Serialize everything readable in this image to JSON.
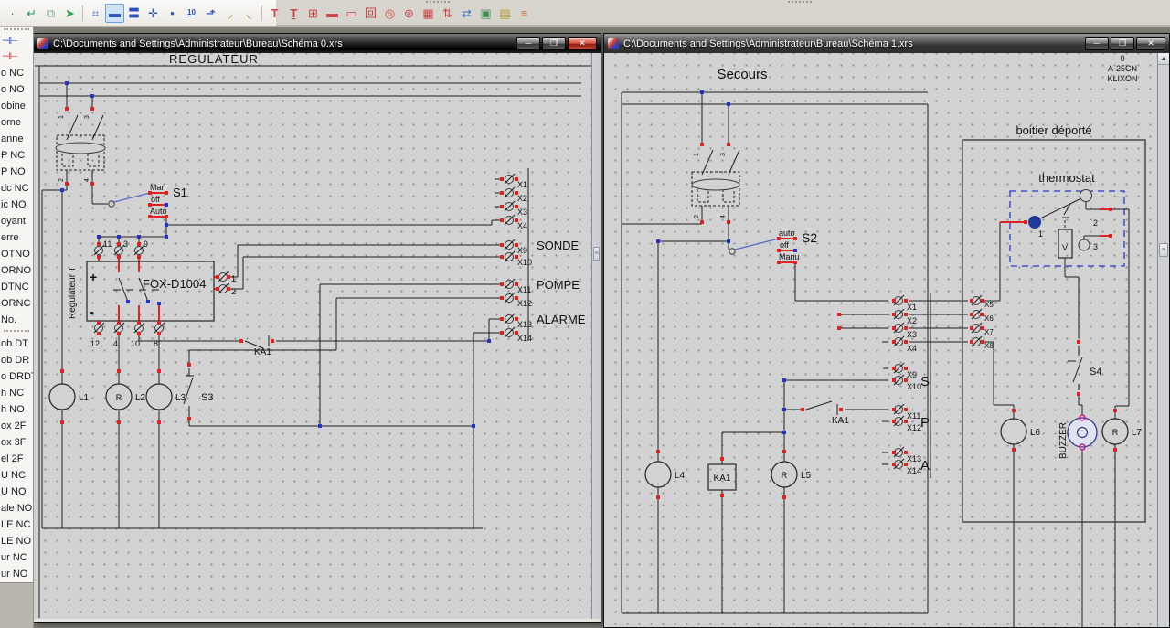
{
  "toolbar": {
    "icons": [
      {
        "name": "pointer-dot-icon",
        "glyph": "·",
        "color": "#555555"
      },
      {
        "name": "return-arrow-icon",
        "glyph": "↵",
        "color": "#1f9e63"
      },
      {
        "name": "copy-icon",
        "glyph": "⧉",
        "color": "#7fae8f"
      },
      {
        "name": "paste-arrow-icon",
        "glyph": "➤",
        "color": "#2f9e45"
      },
      {
        "name": "snap-icon",
        "glyph": "⌗",
        "color": "#3b6fc4"
      },
      {
        "name": "line-tool-icon",
        "glyph": "▬",
        "color": "#2a52be"
      },
      {
        "name": "double-line-tool-icon",
        "glyph": "〓",
        "color": "#2a52be"
      },
      {
        "name": "cross-tool-icon",
        "glyph": "✛",
        "color": "#2a52be"
      },
      {
        "name": "point-tool-icon",
        "glyph": "•",
        "color": "#2a52be"
      },
      {
        "name": "dimension-tool-icon",
        "glyph": "10",
        "color": "#2a52be"
      },
      {
        "name": "corner-arrow-tool-icon",
        "glyph": "⬏",
        "color": "#2a52be"
      },
      {
        "name": "arc-down-tool-icon",
        "glyph": "◞",
        "color": "#9a8428"
      },
      {
        "name": "arc-up-tool-icon",
        "glyph": "◟",
        "color": "#9a8428"
      },
      {
        "name": "text-tool-icon",
        "glyph": "T",
        "color": "#c44444"
      },
      {
        "name": "text-cursor-tool-icon",
        "glyph": "Ṯ",
        "color": "#c44444"
      },
      {
        "name": "table-tool-icon",
        "glyph": "⊞",
        "color": "#c44444"
      },
      {
        "name": "bar-tool-icon",
        "glyph": "▬",
        "color": "#c44444"
      },
      {
        "name": "rect-tool-icon",
        "glyph": "▭",
        "color": "#c44444"
      },
      {
        "name": "nested-rect-tool-icon",
        "glyph": "回",
        "color": "#c44444"
      },
      {
        "name": "circle-tool-icon",
        "glyph": "◎",
        "color": "#c44444"
      },
      {
        "name": "small-circle-tool-icon",
        "glyph": "⊚",
        "color": "#c44444"
      },
      {
        "name": "grid-tool-icon",
        "glyph": "▦",
        "color": "#c44444"
      },
      {
        "name": "vertical-arrows-tool-icon",
        "glyph": "⇅",
        "color": "#c44444"
      },
      {
        "name": "horizontal-arrows-tool-icon",
        "glyph": "⇄",
        "color": "#3b6fc4"
      },
      {
        "name": "image-tool-icon",
        "glyph": "▣",
        "color": "#3f8f4f"
      },
      {
        "name": "image2-tool-icon",
        "glyph": "▤",
        "color": "#b09a2f"
      },
      {
        "name": "lines-tool-icon",
        "glyph": "≡",
        "color": "#c87a3a"
      }
    ]
  },
  "sidebar": {
    "palette_icons": [
      "⊣⊢",
      "⊣⊢"
    ],
    "items": [
      "o NC",
      "o NO",
      "obine",
      "orne",
      "anne",
      "P NC",
      "P NO",
      "dc NC",
      "ic NO",
      "oyant",
      "erre",
      "OTNO",
      "ORNO",
      "DTNC",
      "ORNC",
      "No.",
      "ob DT",
      "ob DR",
      "o DRDT",
      "h NC",
      "h NO",
      "ox 2F",
      "ox 3F",
      "el 2F",
      "U NC",
      "U NO",
      "ale NO",
      "LE NC",
      "LE NO",
      "ur NC",
      "ur NO"
    ]
  },
  "chrome": {
    "minimize": "─",
    "maximize": "❐",
    "close": "✕"
  },
  "colors": {
    "wire": "#1d1d1d",
    "terminal_red": "#e02222",
    "junction_blue": "#2434c8",
    "canvas": "#d2d2d2"
  },
  "left": {
    "title": "C:\\Documents and Settings\\Administrateur\\Bureau\\Schéma 0.xrs",
    "heading": "REGULATEUR",
    "breaker": {
      "p1": "1",
      "p3": "3",
      "p2": "2",
      "p4": "4"
    },
    "s1": {
      "label": "S1",
      "man": "Man",
      "off": "off",
      "auto": "Auto"
    },
    "fox": {
      "name": "FOX-D1004",
      "side": "Regulateur T",
      "plus": "+",
      "minus": "-",
      "t11": "11",
      "t3": "3",
      "t9": "9",
      "b12": "12",
      "b4": "4",
      "b10": "10",
      "b8": "8",
      "r1": "1",
      "r2": "2"
    },
    "x": {
      "x1": "X1",
      "x2": "X2",
      "x3": "X3",
      "x4": "X4",
      "x9": "X9",
      "x10": "X10",
      "x11": "X11",
      "x12": "X12",
      "x13": "X13",
      "x14": "X14"
    },
    "out": {
      "sonde": "SONDE",
      "pompe": "POMPE",
      "alarme": "ALARME"
    },
    "ka1": "KA1",
    "l1": "L1",
    "l2": "L2",
    "l3": "L3",
    "r": "R",
    "s3": "S3"
  },
  "right": {
    "title": "C:\\Documents and Settings\\Administrateur\\Bureau\\Schéma 1.xrs",
    "heading": "Secours",
    "corner": {
      "a": "0",
      "b": "A-25CN",
      "c": "KLIXON"
    },
    "breaker": {
      "p1": "1",
      "p3": "3",
      "p2": "2",
      "p4": "4"
    },
    "s2": {
      "label": "S2",
      "auto": "auto",
      "off": "off",
      "manu": "Manu"
    },
    "box": "boitier déporté",
    "thermo": {
      "label": "thermostat",
      "p1": "1",
      "p2": "2",
      "p3": "3",
      "v": "V"
    },
    "x": {
      "x1": "X1",
      "x2": "X2",
      "x3": "X3",
      "x4": "X4",
      "x5": "X5",
      "x6": "X6",
      "x7": "X7",
      "x8": "X8",
      "x9": "X9",
      "x10": "X10",
      "x11": "X11",
      "x12": "X12",
      "x13": "X13",
      "x14": "X14"
    },
    "letters": {
      "s": "S",
      "p": "P",
      "a": "A"
    },
    "ka1_contact": "KA1",
    "ka1_coil": "KA1",
    "l4": "L4",
    "l5": "L5",
    "l6": "L6",
    "l7": "L7",
    "r": "R",
    "s4": "S4",
    "buzzer": "BUZZER"
  }
}
